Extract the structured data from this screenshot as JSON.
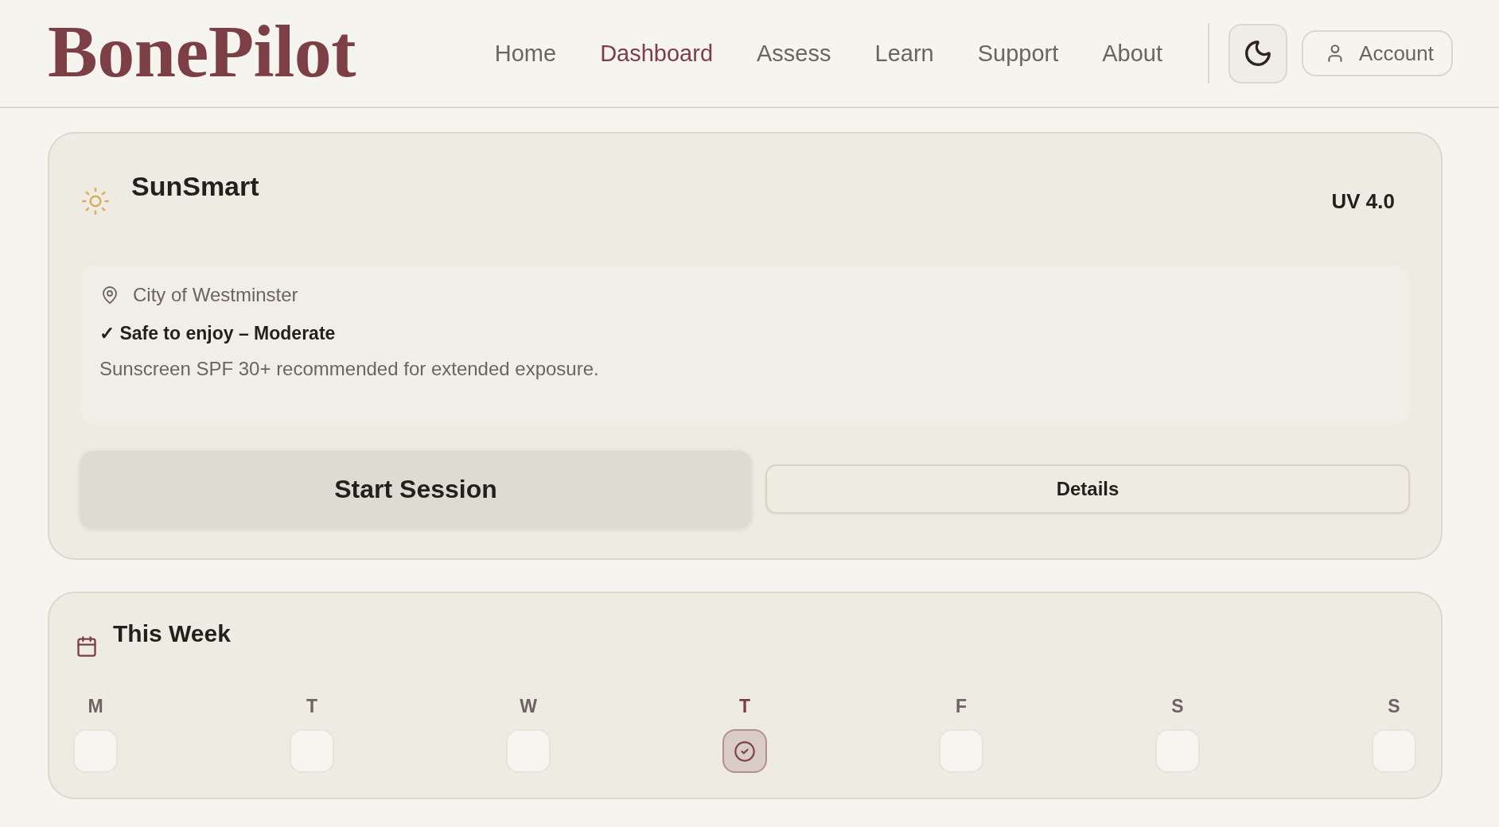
{
  "header": {
    "logo": "BonePilot",
    "nav": [
      {
        "label": "Home",
        "selected": false
      },
      {
        "label": "Dashboard",
        "selected": true
      },
      {
        "label": "Assess",
        "selected": false
      },
      {
        "label": "Learn",
        "selected": false
      },
      {
        "label": "Support",
        "selected": false
      },
      {
        "label": "About",
        "selected": false
      }
    ],
    "account_button": {
      "label": "Account"
    }
  },
  "sun_card": {
    "title": "SunSmart",
    "uv_reading": "UV 4.0",
    "location": "City of Westminster",
    "status": "✓ Safe to enjoy – Moderate",
    "advice": "Sunscreen SPF 30+ recommended for extended exposure.",
    "buttons": [
      {
        "label": "Start Session",
        "kind": "primary"
      },
      {
        "label": "Details",
        "kind": "secondary"
      }
    ]
  },
  "week_card": {
    "title": "This Week",
    "days": [
      {
        "label": "M",
        "completed": false
      },
      {
        "label": "T",
        "completed": false
      },
      {
        "label": "W",
        "completed": false
      },
      {
        "label": "T",
        "completed": true
      },
      {
        "label": "F",
        "completed": false
      },
      {
        "label": "S",
        "completed": false
      },
      {
        "label": "S",
        "completed": false
      }
    ]
  }
}
